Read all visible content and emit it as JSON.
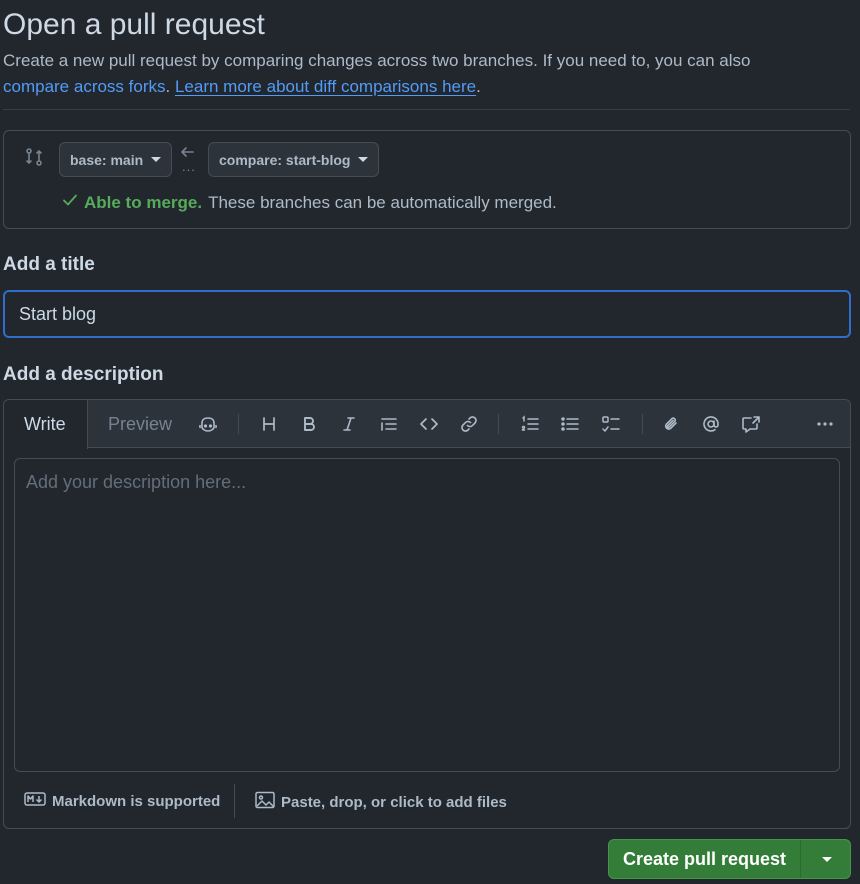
{
  "header": {
    "title": "Open a pull request",
    "subtitle": "Create a new pull request by comparing changes across two branches. If you need to, you can also",
    "link_forks": "compare across forks",
    "link_sep": ". ",
    "link_learn": "Learn more about diff comparisons here",
    "link_end": "."
  },
  "compare": {
    "base_label": "base: main",
    "compare_label": "compare: start-blog",
    "dots": "...",
    "merge_status": "Able to merge.",
    "merge_text": "These branches can be automatically merged."
  },
  "title_section": {
    "label": "Add a title",
    "value": "Start blog"
  },
  "description": {
    "label": "Add a description",
    "tab_write": "Write",
    "tab_preview": "Preview",
    "placeholder": "Add your description here...",
    "markdown_note": "Markdown is supported",
    "files_note": "Paste, drop, or click to add files"
  },
  "submit": {
    "label": "Create pull request"
  },
  "colors": {
    "background": "#22272e",
    "accent": "#539bf5",
    "success": "#57ab5a",
    "primary_button": "#347d39"
  }
}
